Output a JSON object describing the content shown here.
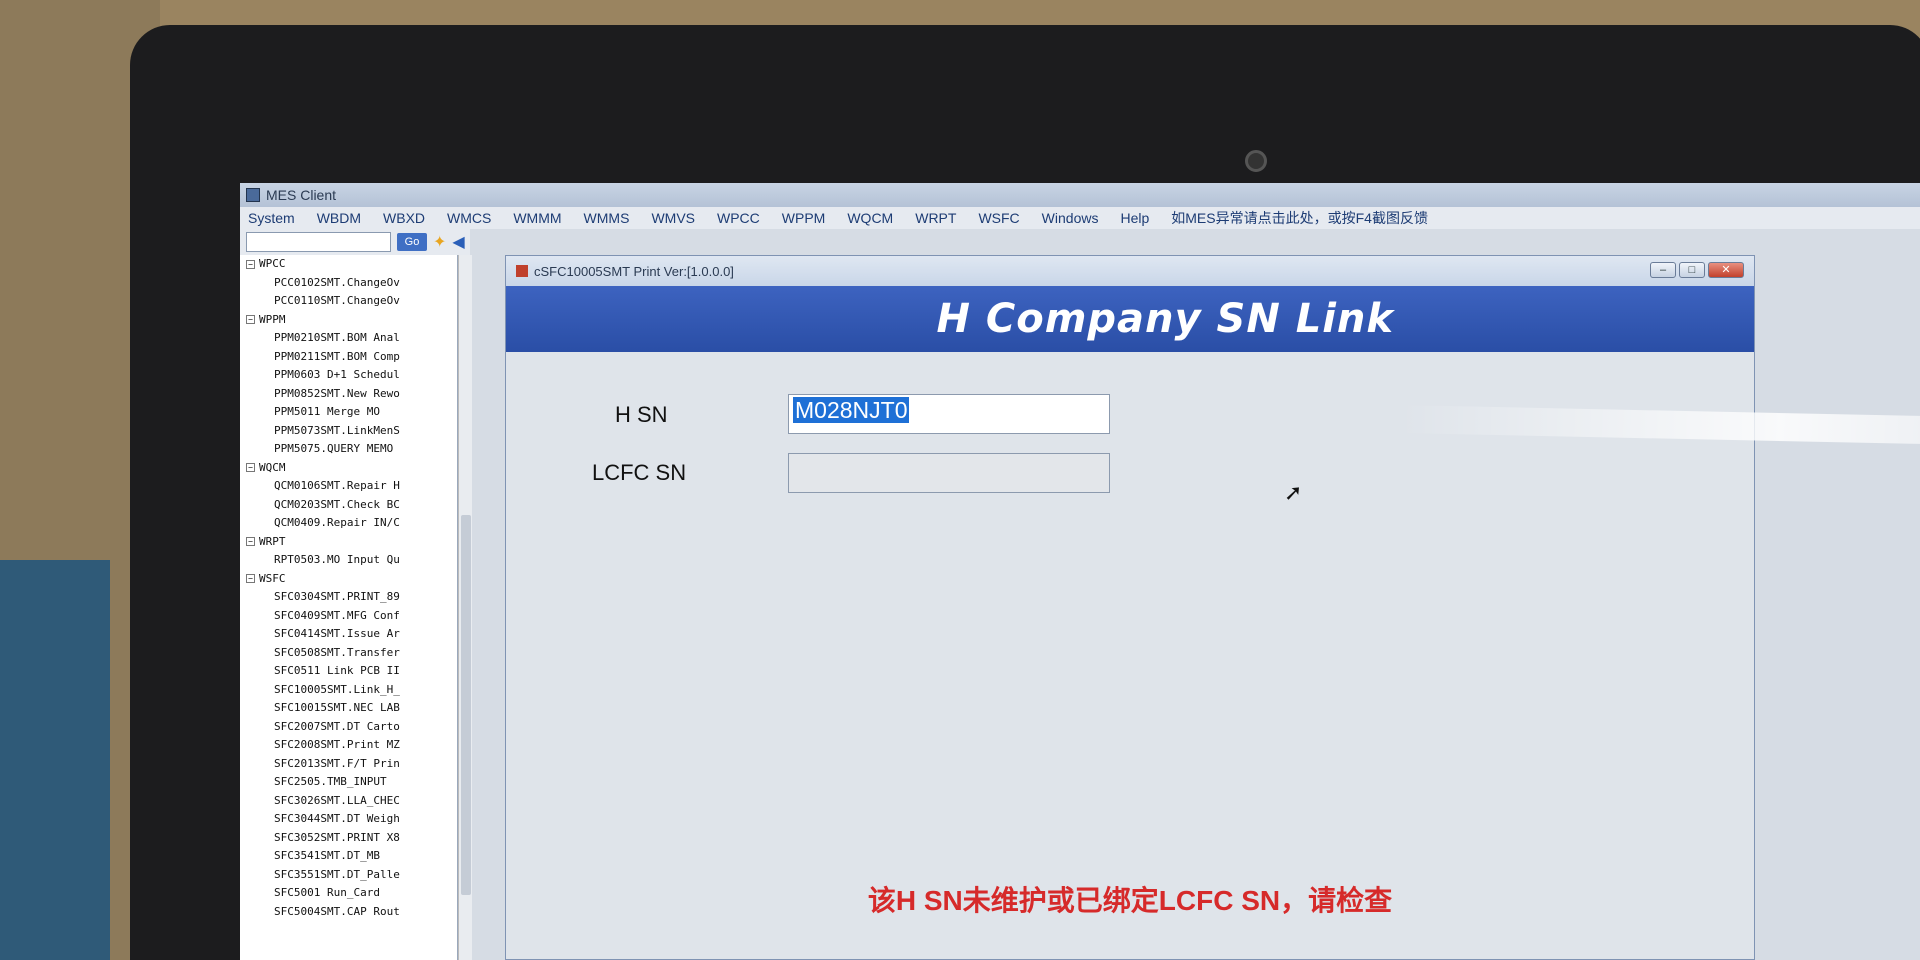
{
  "app": {
    "title": "MES Client"
  },
  "menu": [
    "System",
    "WBDM",
    "WBXD",
    "WMCS",
    "WMMM",
    "WMMS",
    "WMVS",
    "WPCC",
    "WPPM",
    "WQCM",
    "WRPT",
    "WSFC",
    "Windows",
    "Help",
    "如MES异常请点击此处，或按F4截图反馈"
  ],
  "toolbar": {
    "go_label": "Go",
    "star_icon": "star-icon",
    "back_icon": "back-arrow-icon"
  },
  "tree": [
    {
      "type": "group",
      "label": "WPCC"
    },
    {
      "type": "leaf",
      "label": "PCC0102SMT.ChangeOv"
    },
    {
      "type": "leaf",
      "label": "PCC0110SMT.ChangeOv"
    },
    {
      "type": "group",
      "label": "WPPM"
    },
    {
      "type": "leaf",
      "label": "PPM0210SMT.BOM Anal"
    },
    {
      "type": "leaf",
      "label": "PPM0211SMT.BOM Comp"
    },
    {
      "type": "leaf",
      "label": "PPM0603 D+1 Schedul"
    },
    {
      "type": "leaf",
      "label": "PPM0852SMT.New Rewo"
    },
    {
      "type": "leaf",
      "label": "PPM5011 Merge MO"
    },
    {
      "type": "leaf",
      "label": "PPM5073SMT.LinkMenS"
    },
    {
      "type": "leaf",
      "label": "PPM5075.QUERY MEMO"
    },
    {
      "type": "group",
      "label": "WQCM"
    },
    {
      "type": "leaf",
      "label": "QCM0106SMT.Repair H"
    },
    {
      "type": "leaf",
      "label": "QCM0203SMT.Check BC"
    },
    {
      "type": "leaf",
      "label": "QCM0409.Repair IN/C"
    },
    {
      "type": "group",
      "label": "WRPT"
    },
    {
      "type": "leaf",
      "label": "RPT0503.MO Input Qu"
    },
    {
      "type": "group",
      "label": "WSFC"
    },
    {
      "type": "leaf",
      "label": "SFC0304SMT.PRINT_89"
    },
    {
      "type": "leaf",
      "label": "SFC0409SMT.MFG Conf"
    },
    {
      "type": "leaf",
      "label": "SFC0414SMT.Issue Ar"
    },
    {
      "type": "leaf",
      "label": "SFC0508SMT.Transfer"
    },
    {
      "type": "leaf",
      "label": "SFC0511 Link PCB II"
    },
    {
      "type": "leaf",
      "label": "SFC10005SMT.Link_H_"
    },
    {
      "type": "leaf",
      "label": "SFC10015SMT.NEC LAB"
    },
    {
      "type": "leaf",
      "label": "SFC2007SMT.DT Carto"
    },
    {
      "type": "leaf",
      "label": "SFC2008SMT.Print MZ"
    },
    {
      "type": "leaf",
      "label": "SFC2013SMT.F/T Prin"
    },
    {
      "type": "leaf",
      "label": "SFC2505.TMB_INPUT"
    },
    {
      "type": "leaf",
      "label": "SFC3026SMT.LLA_CHEC"
    },
    {
      "type": "leaf",
      "label": "SFC3044SMT.DT Weigh"
    },
    {
      "type": "leaf",
      "label": "SFC3052SMT.PRINT X8"
    },
    {
      "type": "leaf",
      "label": "SFC3541SMT.DT_MB"
    },
    {
      "type": "leaf",
      "label": "SFC3551SMT.DT_Palle"
    },
    {
      "type": "leaf",
      "label": "SFC5001 Run_Card"
    },
    {
      "type": "leaf",
      "label": "SFC5004SMT.CAP Rout"
    }
  ],
  "child_window": {
    "title": "cSFC10005SMT Print Ver:[1.0.0.0]",
    "minimize_label": "–",
    "maximize_label": "□",
    "close_label": "✕",
    "banner_title": "H Company SN Link"
  },
  "form": {
    "hsn_label": "H SN",
    "hsn_value": "M028NJT0",
    "lcfc_label": "LCFC SN",
    "lcfc_value": ""
  },
  "status": {
    "message": "该H SN未维护或已绑定LCFC SN，请检查",
    "color": "#d62a2a"
  }
}
